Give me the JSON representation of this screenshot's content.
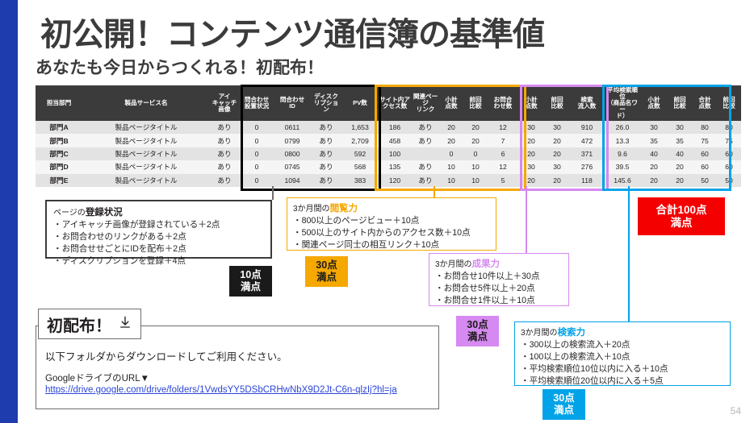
{
  "slide": {
    "title": "初公開！コンテンツ通信簿の基準値",
    "subtitle": "あなたも今日からつくれる！初配布！",
    "page_number": "54",
    "accent_colors": {
      "left_bar": "#1f3cae",
      "dark": "#3b3b3b",
      "yellow": "#f5a800",
      "purple": "#d689f0",
      "blue": "#00a3e8",
      "red": "#f40000",
      "link": "#2b44d8"
    }
  },
  "table": {
    "headers": {
      "dept": "担当部門",
      "product": "製品サービス名",
      "eyecatch": "アイ\nキャッチ\n画像",
      "contact_setup": "問合わせ\n設置状況",
      "contact_id": "問合わせ\nID",
      "description": "ディスク\nリプショ\nン",
      "pv": "PV数",
      "internal_access": "サイト内ア\nクセス数",
      "related_link": "関連ペー\nジ\nリンク",
      "subtotal1": "小計\n点数",
      "prev1": "前回\n比較",
      "inquiries": "お問合\nわせ数",
      "subtotal2": "小計\n点数",
      "prev2": "前回\n比較",
      "search_inflow": "検索\n流入数",
      "avg_rank": "平均検索順位\n（商品名ワー\nド）",
      "subtotal3": "小計\n点数",
      "prev3": "前回\n比較",
      "total": "合計\n点数",
      "prev_total": "前回\n比較"
    },
    "header_labels_flat": {
      "eyecatch_l1": "アイ",
      "eyecatch_l2": "キャッチ",
      "eyecatch_l3": "画像",
      "contact_setup_l1": "問合わせ",
      "contact_setup_l2": "設置状況",
      "contact_id_l1": "問合わせ",
      "contact_id_l2": "ID",
      "description_l1": "ディスク",
      "description_l2": "リプショ",
      "description_l3": "ン",
      "pv_l1": "PV数",
      "internal_l1": "サイト内ア",
      "internal_l2": "クセス数",
      "related_l1": "関連ペー",
      "related_l2": "ジ",
      "related_l3": "リンク",
      "sub_l1": "小計",
      "sub_l2": "点数",
      "prev_l1": "前回",
      "prev_l2": "比較",
      "inq_l1": "お問合",
      "inq_l2": "わせ数",
      "sinflow_l1": "検索",
      "sinflow_l2": "流入数",
      "avgrank_l1": "平均検索順位",
      "avgrank_l2": "（商品名ワー",
      "avgrank_l3": "ド）",
      "total_l1": "合計",
      "total_l2": "点数"
    },
    "rows": [
      {
        "dept": "部門A",
        "product": "製品ページタイトル",
        "eyecatch": "あり",
        "contact_setup": "0",
        "contact_id": "0611",
        "description": "あり",
        "pv": "1,653",
        "internal_access": "186",
        "related_link": "あり",
        "subtotal1": "20",
        "prev1": "20",
        "inquiries": "12",
        "subtotal2": "30",
        "prev2": "30",
        "search_inflow": "910",
        "avg_rank": "26.0",
        "subtotal3": "30",
        "prev3": "30",
        "total": "80",
        "prev_total": "80"
      },
      {
        "dept": "部門B",
        "product": "製品ページタイトル",
        "eyecatch": "あり",
        "contact_setup": "0",
        "contact_id": "0799",
        "description": "あり",
        "pv": "2,709",
        "internal_access": "458",
        "related_link": "あり",
        "subtotal1": "20",
        "prev1": "20",
        "inquiries": "7",
        "subtotal2": "20",
        "prev2": "20",
        "search_inflow": "472",
        "avg_rank": "13.3",
        "subtotal3": "35",
        "prev3": "35",
        "total": "75",
        "prev_total": "75"
      },
      {
        "dept": "部門C",
        "product": "製品ページタイトル",
        "eyecatch": "あり",
        "contact_setup": "0",
        "contact_id": "0800",
        "description": "あり",
        "pv": "592",
        "internal_access": "100",
        "related_link": "",
        "subtotal1": "0",
        "prev1": "0",
        "inquiries": "6",
        "subtotal2": "20",
        "prev2": "20",
        "search_inflow": "371",
        "avg_rank": "9.6",
        "subtotal3": "40",
        "prev3": "40",
        "total": "60",
        "prev_total": "60"
      },
      {
        "dept": "部門D",
        "product": "製品ページタイトル",
        "eyecatch": "あり",
        "contact_setup": "0",
        "contact_id": "0745",
        "description": "あり",
        "pv": "568",
        "internal_access": "135",
        "related_link": "あり",
        "subtotal1": "10",
        "prev1": "10",
        "inquiries": "12",
        "subtotal2": "30",
        "prev2": "30",
        "search_inflow": "276",
        "avg_rank": "39.5",
        "subtotal3": "20",
        "prev3": "20",
        "total": "60",
        "prev_total": "60"
      },
      {
        "dept": "部門E",
        "product": "製品ページタイトル",
        "eyecatch": "あり",
        "contact_setup": "0",
        "contact_id": "1094",
        "description": "あり",
        "pv": "383",
        "internal_access": "120",
        "related_link": "あり",
        "subtotal1": "10",
        "prev1": "10",
        "inquiries": "5",
        "subtotal2": "20",
        "prev2": "20",
        "search_inflow": "118",
        "avg_rank": "145.6",
        "subtotal3": "20",
        "prev3": "20",
        "total": "50",
        "prev_total": "50"
      }
    ]
  },
  "callouts": {
    "registration": {
      "head_prefix": "ページの",
      "head_accent": "登録状況",
      "items": [
        "・アイキャッチ画像が登録されている＋2点",
        "・お問合わせのリンクがある＋2点",
        "・お問合せせごとにIDを配布＋2点",
        "・ディスクリプションを登録＋4点"
      ],
      "chip_l1": "10点",
      "chip_l2": "満点"
    },
    "views": {
      "head_prefix": "3か月間の",
      "head_accent": "閲覧力",
      "items": [
        "・800以上のページビュー＋10点",
        "・500以上のサイト内からのアクセス数＋10点",
        "・関連ページ同士の相互リンク＋10点"
      ],
      "chip_l1": "30点",
      "chip_l2": "満点"
    },
    "results": {
      "head_prefix": "3か月間の",
      "head_accent": "成果力",
      "items": [
        "・お問合せ10件以上＋30点",
        "・お問合せ5件以上＋20点",
        "・お問合せ1件以上＋10点"
      ],
      "chip_l1": "30点",
      "chip_l2": "満点"
    },
    "search": {
      "head_prefix": "3か月間の",
      "head_accent": "検索力",
      "items": [
        "・300以上の検索流入＋20点",
        "・100以上の検索流入＋10点",
        "・平均検索順位10位以内に入る＋10点",
        "・平均検索順位20位以内に入る＋5点"
      ],
      "chip_l1": "30点",
      "chip_l2": "満点"
    },
    "total_chip": {
      "l1": "合計100点",
      "l2": "満点"
    }
  },
  "download": {
    "tag_label": "初配布！",
    "icon": "download-icon",
    "line1": "以下フォルダからダウンロードしてご利用ください。",
    "line2": "GoogleドライブのURL▼",
    "url": "https://drive.google.com/drive/folders/1VwdsYY5DSbCRHwNbX9D2Jt-C6n-qlzIj?hl=ja"
  }
}
